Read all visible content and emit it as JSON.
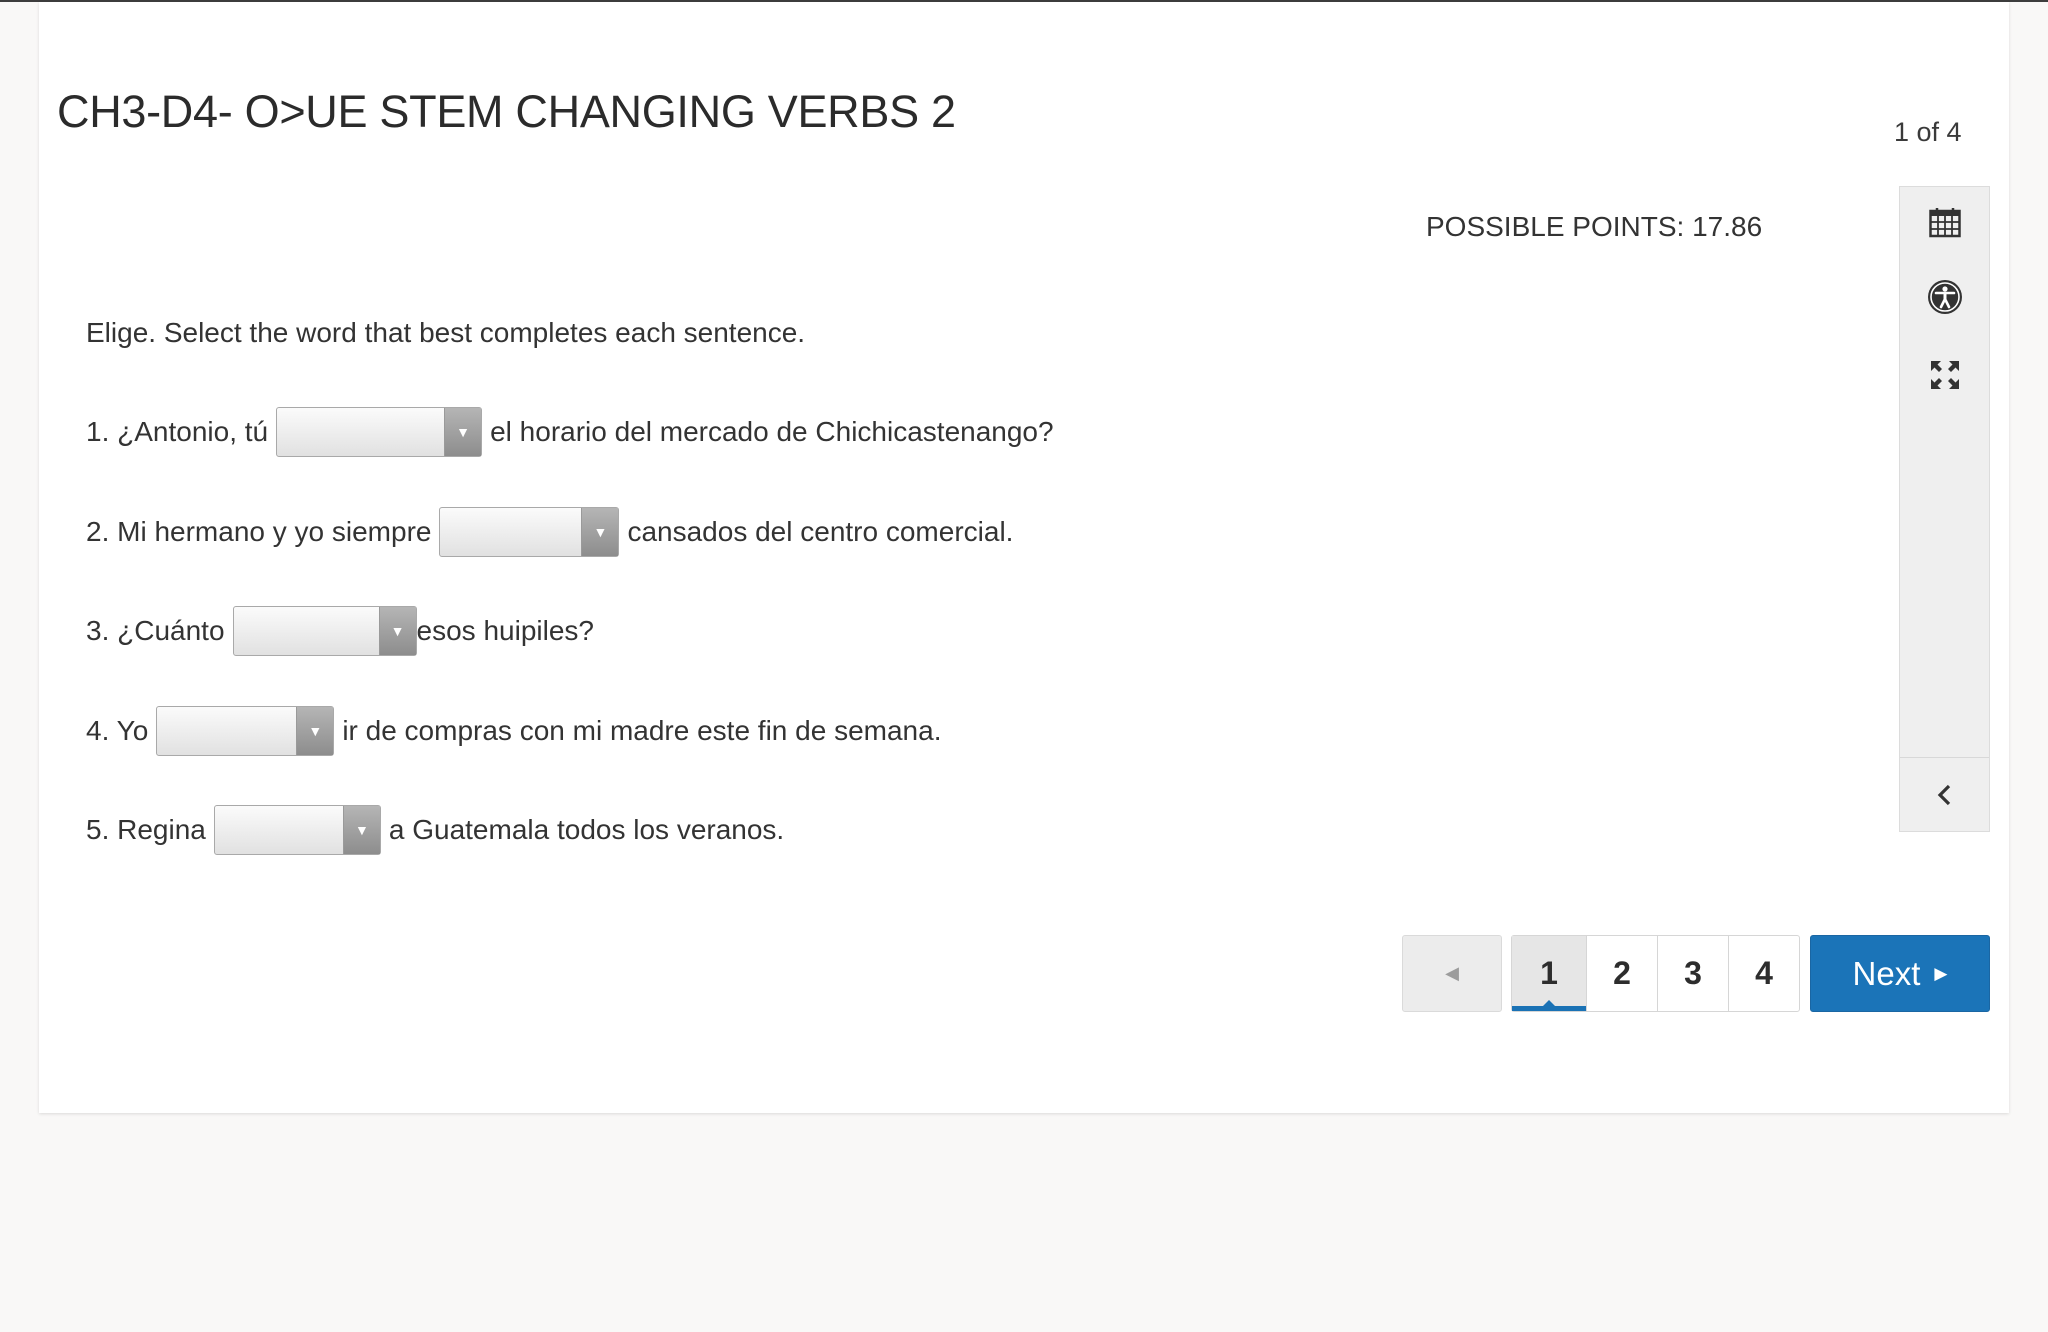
{
  "header": {
    "title": "CH3-D4- O>UE STEM CHANGING VERBS 2",
    "counter": "1 of 4"
  },
  "question": {
    "points": "POSSIBLE POINTS: 17.86",
    "instructions": "Elige. Select the word that best completes each sentence.",
    "items": [
      {
        "before": "1. ¿Antonio, tú",
        "selected": "",
        "after": "el horario del mercado de Chichicastenango?"
      },
      {
        "before": "2. Mi hermano y yo siempre",
        "selected": "",
        "after": "cansados del centro comercial."
      },
      {
        "before": "3. ¿Cuánto",
        "selected": "",
        "after": "esos huipiles?"
      },
      {
        "before": "4. Yo",
        "selected": "",
        "after": "ir de compras con mi madre este fin de semana."
      },
      {
        "before": "5. Regina",
        "selected": "",
        "after": "a Guatemala todos los veranos."
      }
    ]
  },
  "toolbar": {
    "icons": [
      "calendar-icon",
      "accessibility-icon",
      "expand-icon",
      "chevron-left-icon"
    ]
  },
  "pagination": {
    "pages": [
      "1",
      "2",
      "3",
      "4"
    ],
    "current": "1",
    "next_label": "Next"
  },
  "colors": {
    "accent": "#1b74b8",
    "background": "#f9f8f7",
    "card": "#ffffff"
  }
}
